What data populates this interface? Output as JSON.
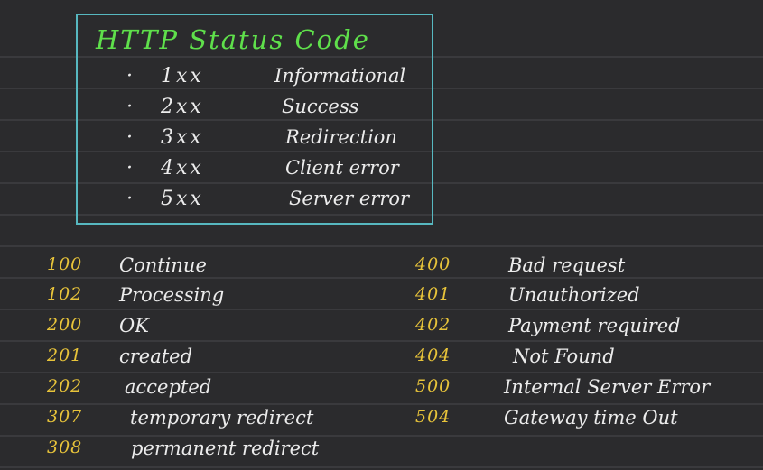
{
  "title": "HTTP Status Code",
  "classes": [
    {
      "bullet": "·",
      "code": "1xx",
      "label": "Informational"
    },
    {
      "bullet": "·",
      "code": "2xx",
      "label": "Success"
    },
    {
      "bullet": "·",
      "code": "3xx",
      "label": "Redirection"
    },
    {
      "bullet": "·",
      "code": "4xx",
      "label": "Client error"
    },
    {
      "bullet": "·",
      "code": "5xx",
      "label": "Server error"
    }
  ],
  "codes_left": [
    {
      "code": "100",
      "label": "Continue"
    },
    {
      "code": "102",
      "label": "Processing"
    },
    {
      "code": "200",
      "label": "OK"
    },
    {
      "code": "201",
      "label": "created"
    },
    {
      "code": "202",
      "label": "accepted"
    },
    {
      "code": "307",
      "label": "temporary redirect"
    },
    {
      "code": "308",
      "label": "permanent redirect"
    }
  ],
  "codes_right": [
    {
      "code": "400",
      "label": "Bad request"
    },
    {
      "code": "401",
      "label": "Unauthorized"
    },
    {
      "code": "402",
      "label": "Payment required"
    },
    {
      "code": "404",
      "label": "Not Found"
    },
    {
      "code": "500",
      "label": "Internal Server Error"
    },
    {
      "code": "504",
      "label": "Gateway time Out"
    }
  ],
  "colors": {
    "background": "#2b2b2d",
    "ruled_line": "#3a3a3d",
    "box_border": "#57b8c0",
    "title": "#5fe04b",
    "code_number": "#e8c43a",
    "text": "#ececec"
  }
}
